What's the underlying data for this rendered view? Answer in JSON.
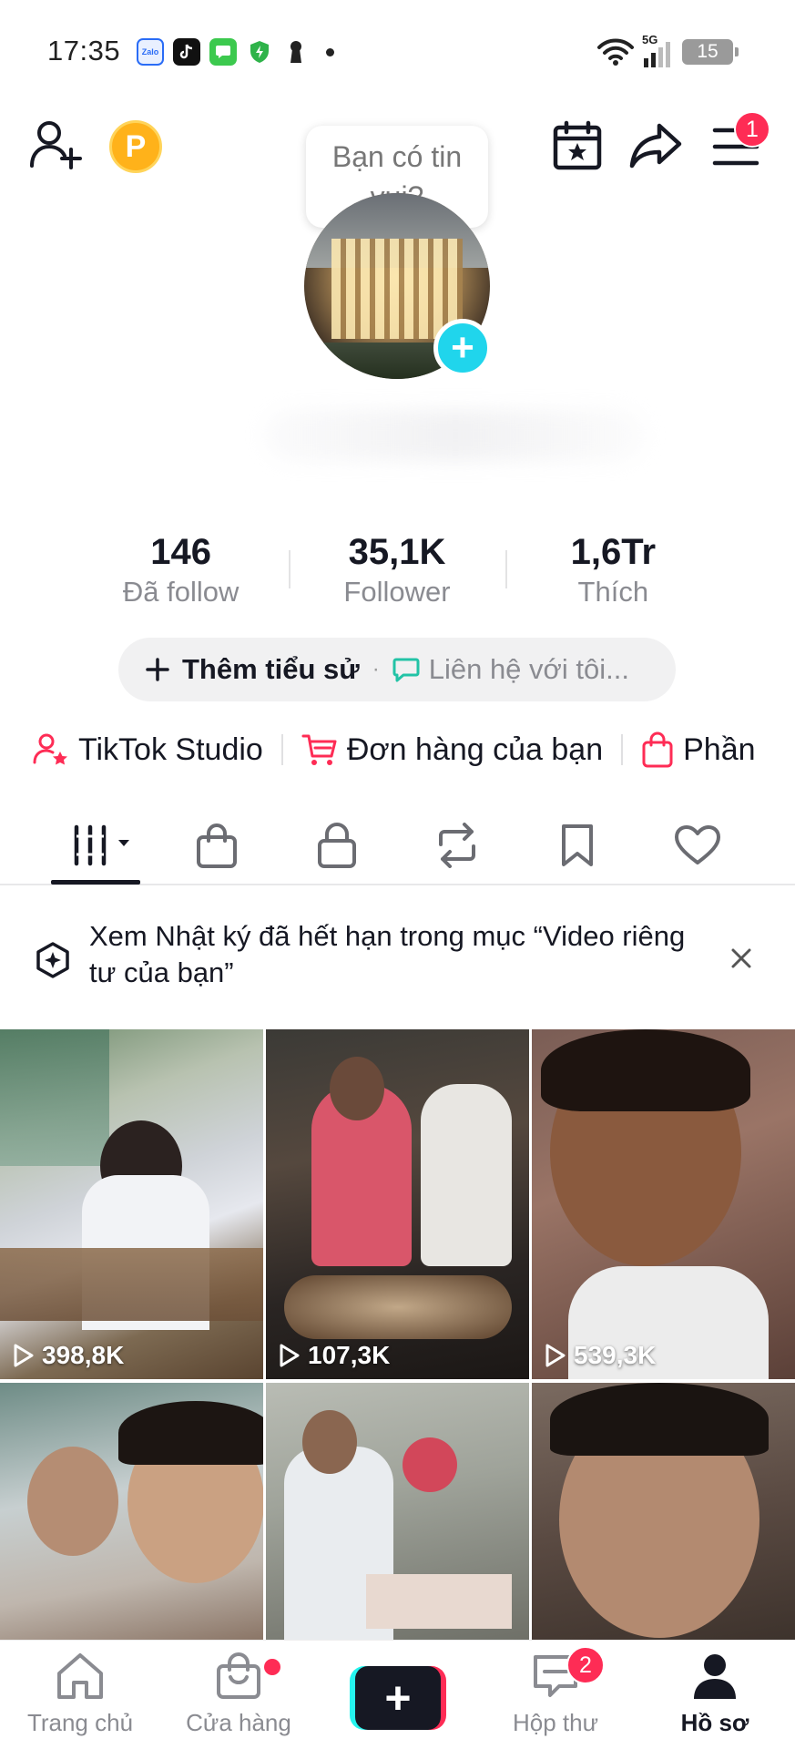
{
  "status_bar": {
    "time": "17:35",
    "network": "5G",
    "battery": "15",
    "notification_apps": [
      "zalo-icon",
      "tiktok-icon",
      "messages-icon",
      "shield-icon",
      "keyhole-icon"
    ]
  },
  "header": {
    "points_label": "P",
    "menu_badge": "1",
    "tooltip": "Bạn có tin vui?"
  },
  "stats": [
    {
      "value": "146",
      "label": "Đã follow"
    },
    {
      "value": "35,1K",
      "label": "Follower"
    },
    {
      "value": "1,6Tr",
      "label": "Thích"
    }
  ],
  "bio": {
    "add_bio": "Thêm tiểu sử",
    "separator": "·",
    "contact": "Liên hệ với tôi..."
  },
  "shortcuts": [
    {
      "label": "TikTok Studio",
      "icon": "person-star-icon"
    },
    {
      "label": "Đơn hàng của bạn",
      "icon": "cart-icon"
    },
    {
      "label": "Phần",
      "icon": "shopping-bag-icon"
    }
  ],
  "tabs": [
    "videos-grid-icon",
    "shop-bag-icon",
    "private-lock-icon",
    "repost-icon",
    "saved-bookmark-icon",
    "liked-heart-icon"
  ],
  "banner": {
    "text": "Xem Nhật ký đã hết hạn trong mục “Video riêng tư của bạn”"
  },
  "videos": [
    {
      "views": "398,8K"
    },
    {
      "views": "107,3K"
    },
    {
      "views": "539,3K"
    },
    {
      "views": ""
    },
    {
      "views": ""
    },
    {
      "views": ""
    }
  ],
  "bottom_nav": {
    "home": "Trang chủ",
    "shop": "Cửa hàng",
    "create": "+",
    "inbox": "Hộp thư",
    "inbox_badge": "2",
    "profile": "Hồ sơ"
  },
  "colors": {
    "accent_red": "#fe2c55",
    "accent_cyan": "#20d5ec",
    "text_primary": "#161823",
    "text_secondary": "#8a8b91"
  }
}
